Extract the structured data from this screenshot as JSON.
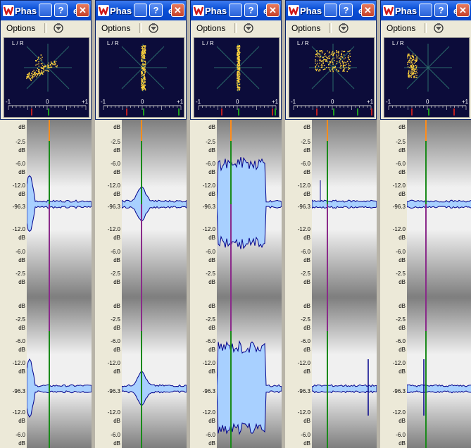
{
  "window": {
    "title_visible": "Phas",
    "title_trailing": "e",
    "menu_options": "Options",
    "help_glyph": "?",
    "close_glyph": "✕",
    "scope_label": "L / R",
    "ruler_labels": [
      "-1",
      "0",
      "+1"
    ]
  },
  "scale_labels": {
    "top": [
      "dB",
      "-2.5",
      "dB",
      "-6.0",
      "dB",
      "-12.0",
      "dB",
      "-96.3",
      "-12.0",
      "dB",
      "-6.0",
      "dB",
      "-2.5",
      "dB"
    ],
    "bottom": [
      "dB",
      "-2.5",
      "dB",
      "-6.0",
      "dB",
      "-12.0",
      "dB",
      "-96.3",
      "-12.0",
      "dB",
      "-6.0",
      "dB"
    ]
  },
  "colors": {
    "title_bar": "#0a4fd6",
    "scope_bg": "#0c0c3a",
    "scope_dots": "#ffd23c",
    "wave_fill": "#a8d0ff",
    "wave_edge": "#00008b",
    "cursor_green": "#1a8a1a",
    "cursor_purple": "#8a2a8a",
    "cursor_orange": "#ff8c1a"
  },
  "columns": [
    {
      "name": "col1",
      "pattern": "cluster",
      "wave": "burst-left"
    },
    {
      "name": "col2",
      "pattern": "vertical",
      "wave": "burst-mid"
    },
    {
      "name": "col3",
      "pattern": "vertical",
      "wave": "sustained"
    },
    {
      "name": "col4",
      "pattern": "spread",
      "wave": "flat"
    },
    {
      "name": "col5",
      "pattern": "left-spread",
      "wave": "flat-spike"
    }
  ]
}
